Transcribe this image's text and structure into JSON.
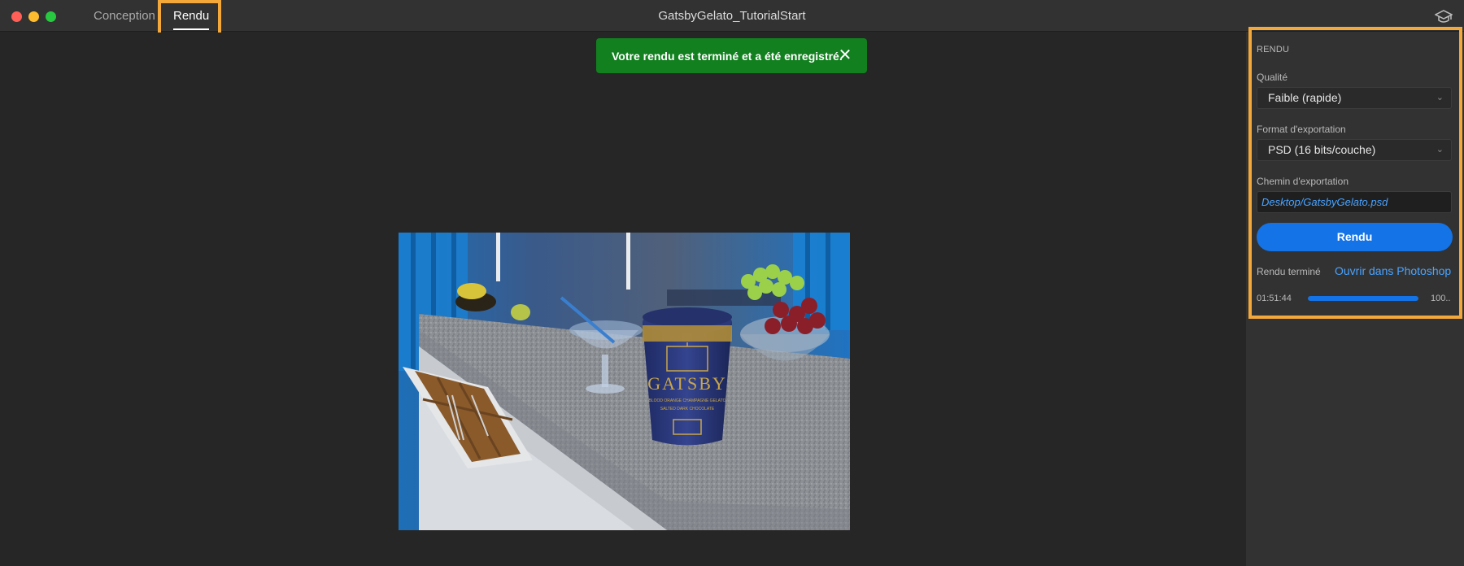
{
  "window": {
    "title": "GatsbyGelato_TutorialStart"
  },
  "tabs": [
    {
      "label": "Conception"
    },
    {
      "label": "Rendu"
    }
  ],
  "toast": {
    "message": "Votre rendu est terminé et a été enregistré.",
    "close_icon": "close-icon"
  },
  "render": {
    "image_alt": "Render preview",
    "product_text": [
      "GATSBY",
      "BLOOD ORANGE CHAMPAGNE GELATO",
      "SALTED DARK CHOCOLATE"
    ]
  },
  "panel": {
    "section_title": "RENDU",
    "quality_label": "Qualité",
    "quality_value": "Faible (rapide)",
    "format_label": "Format d'exportation",
    "format_value": "PSD (16 bits/couche)",
    "path_label": "Chemin d'exportation",
    "path_value": "Desktop/GatsbyGelato.psd",
    "render_button": "Rendu",
    "status_text": "Rendu terminé",
    "open_link": "Ouvrir dans Photoshop",
    "elapsed": "01:51:44",
    "progress": 1.0,
    "progress_label": "100.."
  },
  "colors": {
    "accent": "#1473e6",
    "highlight": "#f5a83a",
    "toast_bg": "#12801f",
    "link": "#4aa3ff"
  },
  "icons": {
    "learn": "graduation-cap-icon",
    "chevron": "chevron-down-icon"
  }
}
